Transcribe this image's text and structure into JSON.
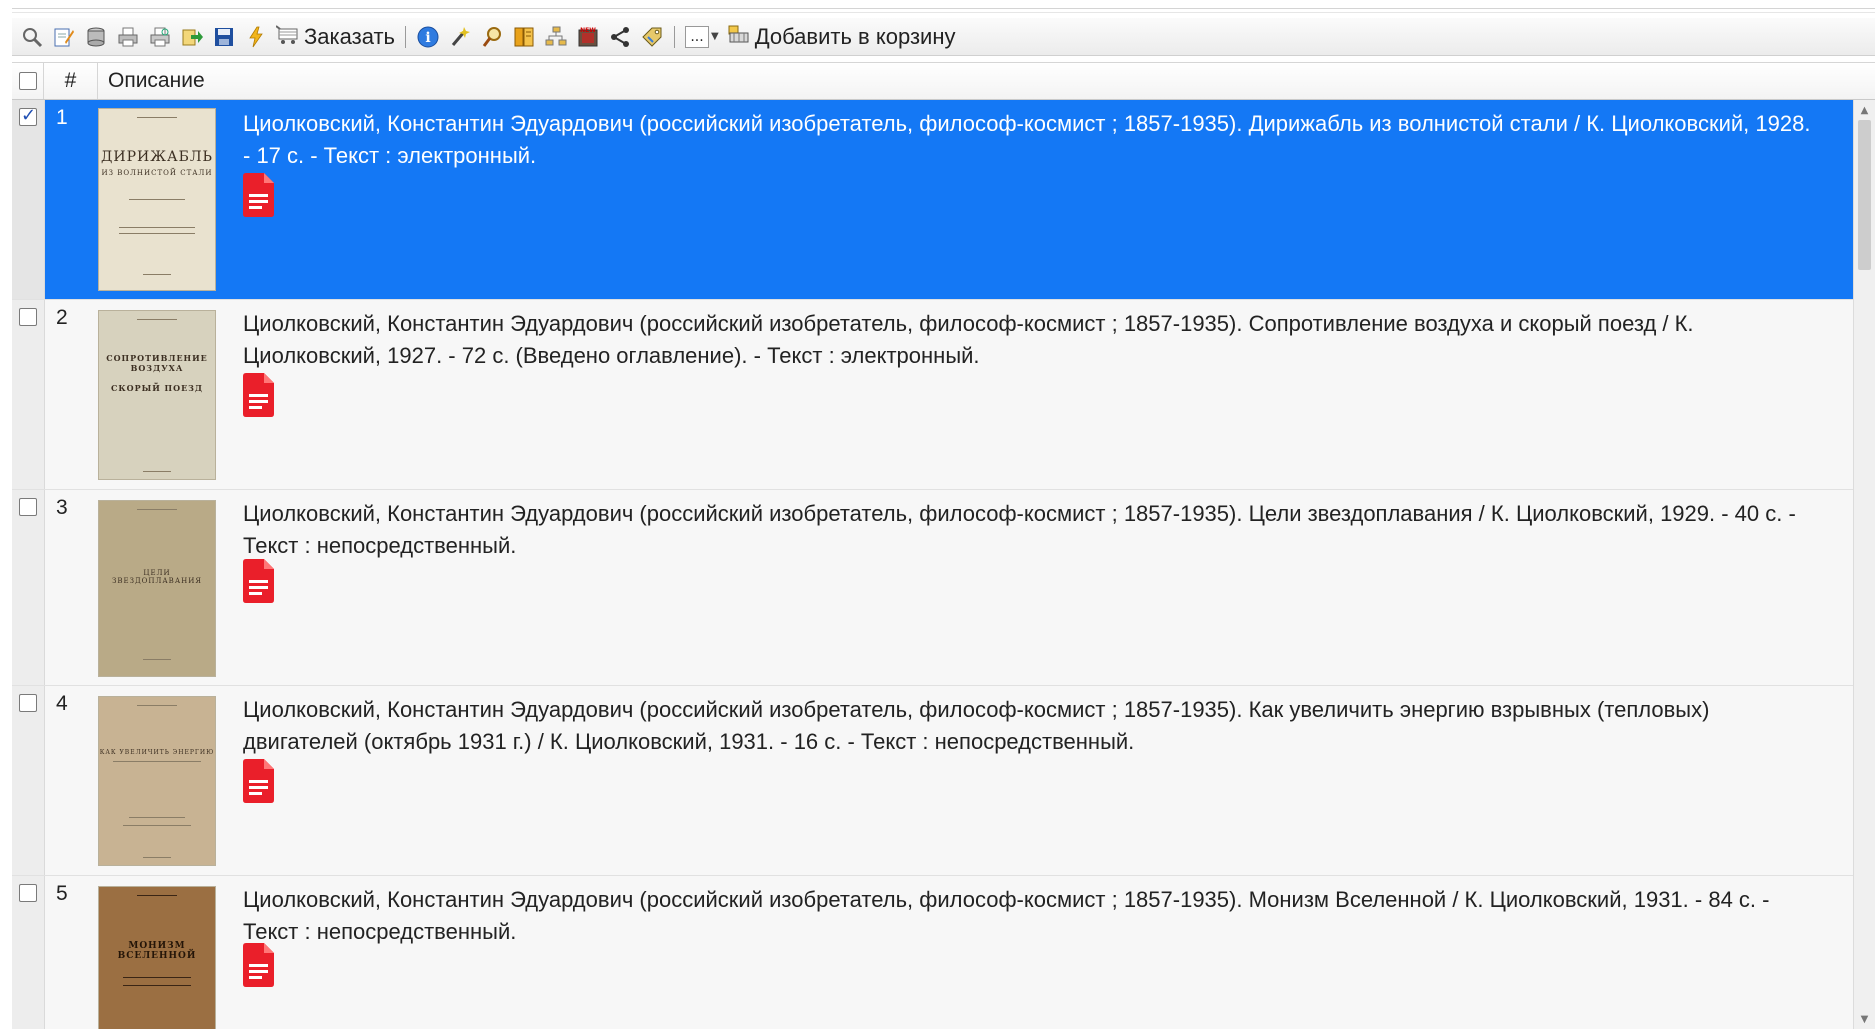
{
  "toolbar": {
    "icons": [
      "search-icon",
      "edit-icon",
      "database-icon",
      "print-icon",
      "print-preview-icon",
      "export-icon",
      "save-icon",
      "flash-icon",
      "cart-icon",
      "info-icon",
      "wand-icon",
      "magnify-icon",
      "catalog-icon",
      "tree-icon",
      "warning-icon",
      "share-icon",
      "tag-icon",
      "more-icon",
      "basket-icon"
    ],
    "order_label": "Заказать",
    "more_label": "...",
    "add_to_cart_label": "Добавить в корзину"
  },
  "header": {
    "num": "#",
    "description": "Описание"
  },
  "rows": [
    {
      "num": "1",
      "selected": true,
      "description": "Циолковский, Константин Эдуардович (российский изобретатель, философ-космист ; 1857-1935). Дирижабль из волнистой стали / К. Циолковский, 1928. - 17 с. - Текст : электронный.",
      "cover_title": "ДИРИЖАБЛЬ",
      "cover_subtitle": "ИЗ ВОЛНИСТОЙ СТАЛИ"
    },
    {
      "num": "2",
      "selected": false,
      "description": "Циолковский, Константин Эдуардович (российский изобретатель, философ-космист ; 1857-1935). Сопротивление воздуха и скорый поезд / К. Циолковский, 1927. - 72 с. (Введено оглавление). - Текст : электронный.",
      "cover_title": "СОПРОТИВЛЕНИЕ ВОЗДУХА",
      "cover_subtitle": "СКОРЫЙ ПОЕЗД"
    },
    {
      "num": "3",
      "selected": false,
      "description": "Циолковский, Константин Эдуардович (российский изобретатель, философ-космист ; 1857-1935). Цели звездоплавания / К. Циолковский, 1929. - 40 с. - Текст : непосредственный.",
      "cover_title": "ЦЕЛИ ЗВЕЗДОПЛАВАНИЯ",
      "cover_subtitle": ""
    },
    {
      "num": "4",
      "selected": false,
      "description": "Циолковский, Константин Эдуардович (российский изобретатель, философ-космист ; 1857-1935). Как увеличить энергию взрывных (тепловых) двигателей (октябрь 1931 г.) / К. Циолковский, 1931. - 16 с. - Текст : непосредственный.",
      "cover_title": "КАК УВЕЛИЧИТЬ ЭНЕРГИЮ",
      "cover_subtitle": ""
    },
    {
      "num": "5",
      "selected": false,
      "description": "Циолковский, Константин Эдуардович (российский изобретатель, философ-космист ; 1857-1935). Монизм Вселенной / К. Циолковский, 1931. - 84 с. - Текст : непосредственный.",
      "cover_title": "МОНИЗМ ВСЕЛЕННОЙ",
      "cover_subtitle": ""
    }
  ],
  "colors": {
    "selected_row": "#1478f5",
    "pdf_icon": "#ea1f2a"
  }
}
